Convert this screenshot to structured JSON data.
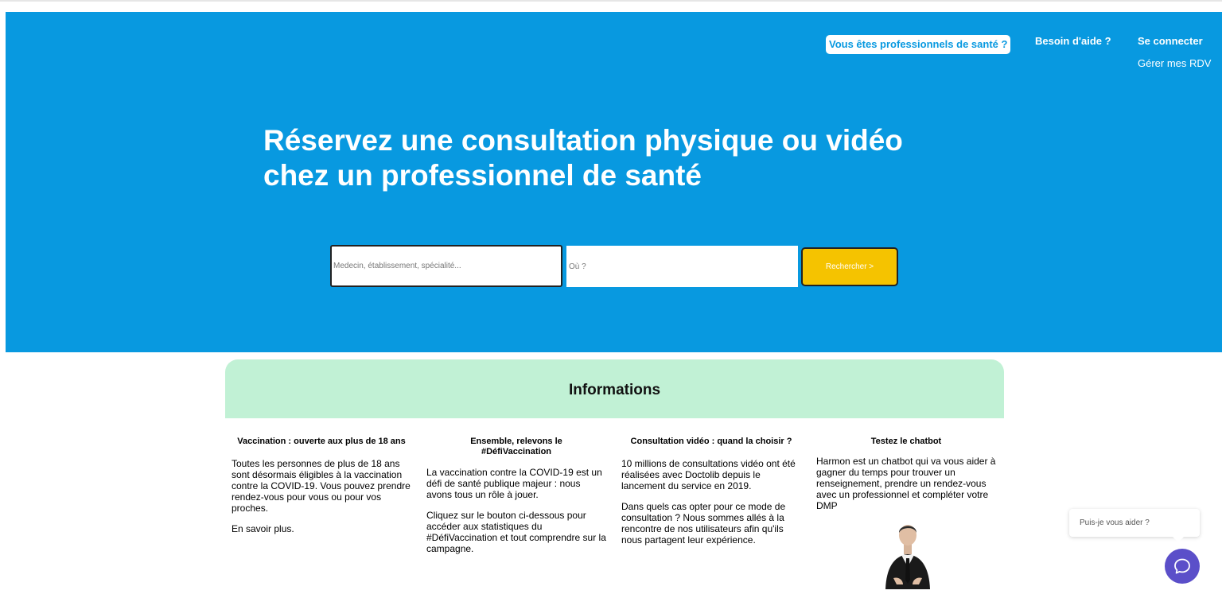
{
  "header": {
    "pro_link": "Vous êtes professionnels de santé ?",
    "help_link": "Besoin d'aide ?",
    "login_link": "Se connecter",
    "manage_link": "Gérer mes RDV"
  },
  "hero": {
    "title_line1": "Réservez une consultation physique ou vidéo",
    "title_line2": "chez un professionnel de santé"
  },
  "search": {
    "what_placeholder": "Medecin, établissement, spécialité...",
    "where_placeholder": "Où ?",
    "button_label": "Rechercher >"
  },
  "info": {
    "title": "Informations",
    "columns": [
      {
        "title": "Vaccination : ouverte aux plus de 18 ans",
        "paragraphs": [
          "Toutes les personnes de plus de 18 ans sont désormais éligibles à la vaccination contre la COVID-19. Vous pouvez prendre rendez-vous pour vous ou pour vos proches.",
          "En savoir plus."
        ]
      },
      {
        "title": "Ensemble, relevons le #DéfiVaccination",
        "paragraphs": [
          "La vaccination contre la COVID-19 est un défi de santé publique majeur : nous avons tous un rôle à jouer.",
          "Cliquez sur le bouton ci-dessous pour accéder aux statistiques du #DéfiVaccination et tout comprendre sur la campagne."
        ]
      },
      {
        "title": "Consultation vidéo : quand la choisir ?",
        "paragraphs": [
          "10 millions de consultations vidéo ont été réalisées avec Doctolib depuis le lancement du service en 2019.",
          "Dans quels cas opter pour ce mode de consultation ? Nous sommes allés à la rencontre de nos utilisateurs afin qu'ils nous partagent leur expérience."
        ]
      },
      {
        "title": "Testez le chatbot",
        "paragraphs": [
          "Harmon est un chatbot qui va vous aider à gagner du temps pour trouver un renseignement, prendre un rendez-vous avec un professionnel et compléter votre DMP"
        ]
      }
    ]
  },
  "chat": {
    "prompt": "Puis-je vous aider ?",
    "icon": "chat-bubble-icon"
  },
  "colors": {
    "hero_bg": "#0899e0",
    "search_button": "#f5c300",
    "info_header_bg": "#c1f1d5",
    "chat_button": "#5b4fc9"
  }
}
